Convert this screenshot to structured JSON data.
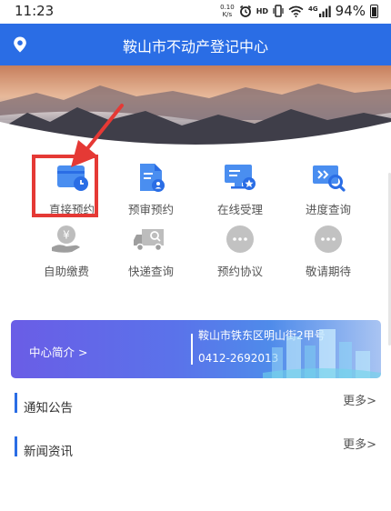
{
  "status_bar": {
    "time": "11:23",
    "net_speed_value": "0.10",
    "net_speed_unit": "K/s",
    "hd_label": "HD",
    "signal_label": "4G",
    "battery_percent": "94%"
  },
  "header": {
    "title": "鞍山市不动产登记中心",
    "color": "#2a6de5"
  },
  "grid": {
    "items": [
      {
        "label": "直接预约",
        "icon": "calendar-card-icon"
      },
      {
        "label": "预审预约",
        "icon": "document-user-icon"
      },
      {
        "label": "在线受理",
        "icon": "monitor-star-icon"
      },
      {
        "label": "进度查询",
        "icon": "fast-forward-search-icon"
      },
      {
        "label": "自助缴费",
        "icon": "yuan-hand-icon"
      },
      {
        "label": "快递查询",
        "icon": "delivery-truck-icon"
      },
      {
        "label": "预约协议",
        "icon": "more-dots-icon"
      },
      {
        "label": "敬请期待",
        "icon": "more-dots-icon"
      }
    ]
  },
  "intro": {
    "link": "中心简介 >",
    "address": "鞍山市铁东区明山街2甲号",
    "phone": "0412-2692013"
  },
  "sections": [
    {
      "title": "通知公告",
      "more": "更多>"
    },
    {
      "title": "新闻资讯",
      "more": "更多>"
    }
  ],
  "accent_colors": {
    "primary": "#2a6de5",
    "highlight": "#e53935"
  }
}
